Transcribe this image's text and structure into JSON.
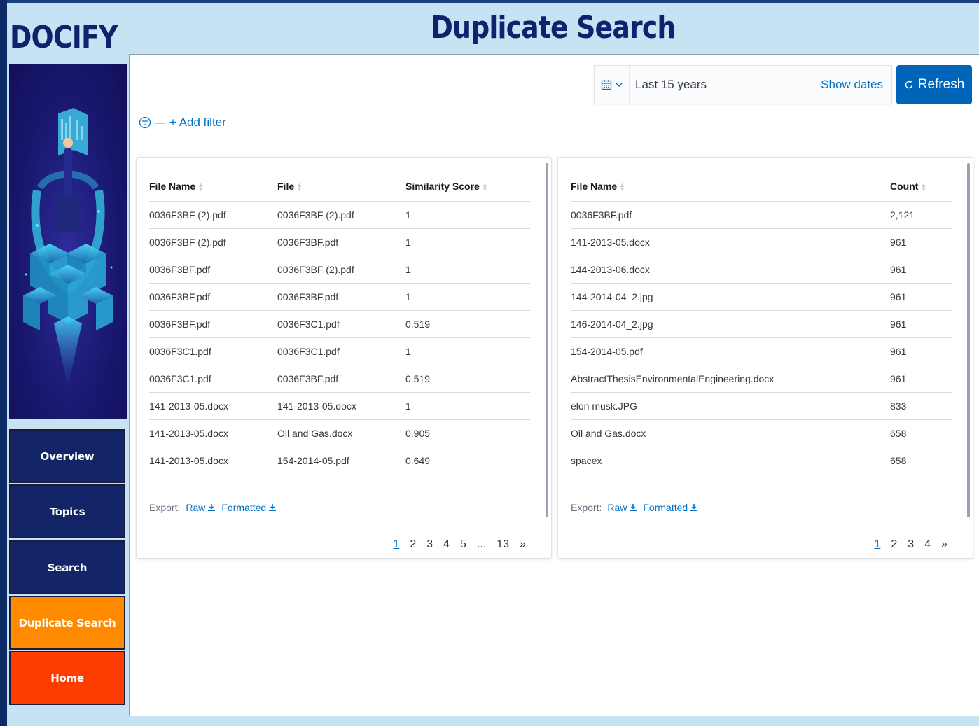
{
  "app": {
    "brand": "DOCIFY",
    "page_title": "Duplicate Search"
  },
  "sidebar": {
    "items": [
      {
        "label": "Overview"
      },
      {
        "label": "Topics"
      },
      {
        "label": "Search"
      },
      {
        "label": "Duplicate Search",
        "active": true
      },
      {
        "label": "Home"
      }
    ]
  },
  "toolbar": {
    "date_range": "Last 15 years",
    "show_dates": "Show dates",
    "refresh": "Refresh",
    "add_filter": "+ Add filter"
  },
  "similarity_table": {
    "columns": [
      "File Name",
      "File",
      "Similarity Score"
    ],
    "rows": [
      [
        "0036F3BF (2).pdf",
        "0036F3BF (2).pdf",
        "1"
      ],
      [
        "0036F3BF (2).pdf",
        "0036F3BF.pdf",
        "1"
      ],
      [
        "0036F3BF.pdf",
        "0036F3BF (2).pdf",
        "1"
      ],
      [
        "0036F3BF.pdf",
        "0036F3BF.pdf",
        "1"
      ],
      [
        "0036F3BF.pdf",
        "0036F3C1.pdf",
        "0.519"
      ],
      [
        "0036F3C1.pdf",
        "0036F3C1.pdf",
        "1"
      ],
      [
        "0036F3C1.pdf",
        "0036F3BF.pdf",
        "0.519"
      ],
      [
        "141-2013-05.docx",
        "141-2013-05.docx",
        "1"
      ],
      [
        "141-2013-05.docx",
        "Oil and Gas.docx",
        "0.905"
      ],
      [
        "141-2013-05.docx",
        "154-2014-05.pdf",
        "0.649"
      ]
    ],
    "export_label": "Export:",
    "export_raw": "Raw",
    "export_formatted": "Formatted",
    "pagination": [
      "1",
      "2",
      "3",
      "4",
      "5",
      "...",
      "13",
      "»"
    ]
  },
  "count_table": {
    "columns": [
      "File Name",
      "Count"
    ],
    "rows": [
      [
        "0036F3BF.pdf",
        "2,121"
      ],
      [
        "141-2013-05.docx",
        "961"
      ],
      [
        "144-2013-06.docx",
        "961"
      ],
      [
        "144-2014-04_2.jpg",
        "961"
      ],
      [
        "146-2014-04_2.jpg",
        "961"
      ],
      [
        "154-2014-05.pdf",
        "961"
      ],
      [
        "AbstractThesisEnvironmentalEngineering.docx",
        "961"
      ],
      [
        "elon musk.JPG",
        "833"
      ],
      [
        "Oil and Gas.docx",
        "658"
      ],
      [
        "spacex",
        "658"
      ]
    ],
    "export_label": "Export:",
    "export_raw": "Raw",
    "export_formatted": "Formatted",
    "pagination": [
      "1",
      "2",
      "3",
      "4",
      "»"
    ]
  },
  "colors": {
    "accent": "#0064b8",
    "nav_dark": "#132566",
    "nav_active": "#ff8a00",
    "nav_home": "#ff3d00",
    "title": "#10226e"
  }
}
